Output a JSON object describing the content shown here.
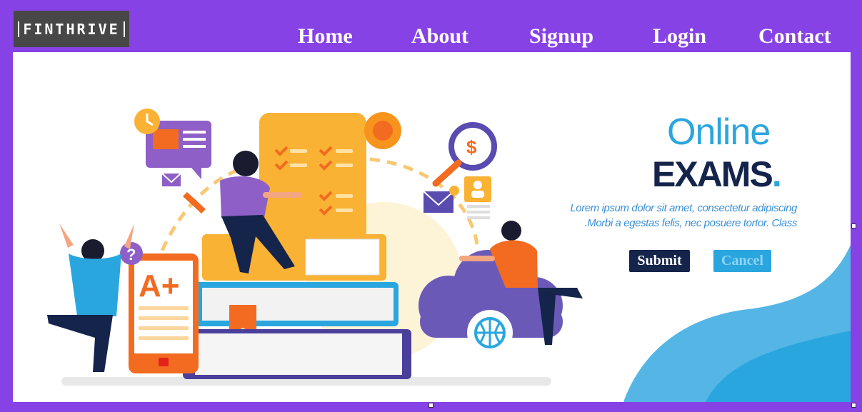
{
  "brand": {
    "logo_text": "FINTHRIVE"
  },
  "nav": {
    "items": [
      {
        "label": "Home"
      },
      {
        "label": "About"
      },
      {
        "label": "Signup"
      },
      {
        "label": "Login"
      },
      {
        "label": "Contact"
      }
    ]
  },
  "hero": {
    "title_line1": "Online",
    "title_line2": "EXAMS",
    "title_dot": ".",
    "description_line1": "Lorem ipsum dolor sit amet, consectetur adipiscing",
    "description_line2": ".Morbi a egestas felis, nec posuere tortor. Class",
    "grade_text": "A+",
    "question_mark": "?",
    "dollar_sign": "$"
  },
  "buttons": {
    "submit_label": "Submit",
    "cancel_label": "Cancel"
  },
  "colors": {
    "page_background": "#8742e6",
    "accent_blue": "#2aa6df",
    "navy": "#14244a",
    "orange": "#f26b21",
    "logo_background": "#474747"
  }
}
